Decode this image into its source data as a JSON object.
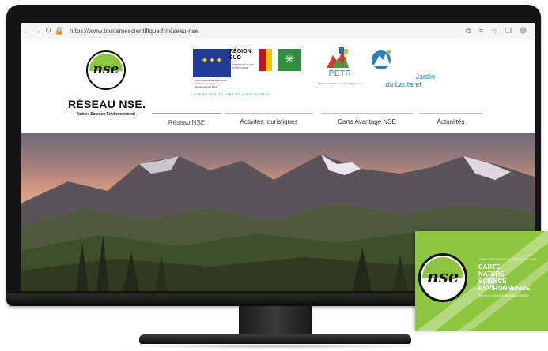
{
  "browser": {
    "url": "https://www.tourismescientifique.fr/réseau-nse",
    "back_icon": "arrow-left",
    "forward_icon": "arrow-right",
    "reload_icon": "reload",
    "lock_icon": "lock"
  },
  "site": {
    "brand_name": "RÉSEAU NSE.",
    "brand_tagline": "Nature Science Environnement",
    "logo_text": "nse",
    "partners": {
      "eu_text": "UNION EUROPÉENNE Fonds Européen Agricole pour le Développement Rural",
      "region_title": "RÉGION SUD",
      "region_sub": "PROVENCE ALPES CÔTE D'AZUR",
      "eu_caption": "L'EUROPE INVESTIT DANS LES ZONES RURALES",
      "petr_label": "PETR",
      "petr_caption": "Briançonnais Écrins Guillestrois Queyras",
      "jardin_line1": "Jardin",
      "jardin_line2": "du Lautaret"
    }
  },
  "nav": {
    "items": [
      {
        "label": "Réseau NSE",
        "active": true
      },
      {
        "label": "Activités touristiques",
        "active": false
      },
      {
        "label": "Carte Avantage NSE",
        "active": false
      },
      {
        "label": "Actualités",
        "active": false
      }
    ]
  },
  "card": {
    "logo_text": "nse",
    "kicker": "UNE EXPÉRIENCE DU 1ER AU 31 JUIN",
    "title": "CARTE\nNATURE\nSCIENCE\nENVIRONNEMNE",
    "subtitle": "PAYS DU GRAND BRIANÇONNAIS"
  },
  "colors": {
    "brand_green": "#8dc63f",
    "partner_blue": "#2b7fb7",
    "eu_blue": "#1f3a93"
  }
}
